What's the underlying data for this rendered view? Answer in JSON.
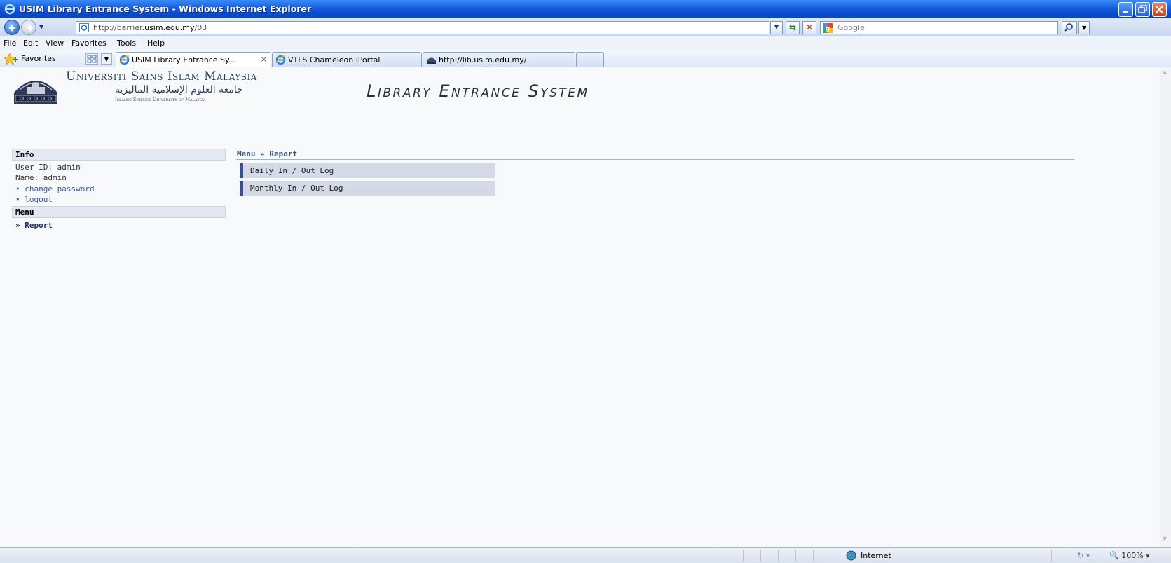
{
  "window": {
    "title": "USIM Library Entrance System - Windows Internet Explorer"
  },
  "address": {
    "url_prefix": "http://barrier.",
    "url_domain": "usim.edu.my",
    "url_suffix": "/03",
    "search_placeholder": "Google"
  },
  "menu": {
    "file": "File",
    "edit": "Edit",
    "view": "View",
    "favorites": "Favorites",
    "tools": "Tools",
    "help": "Help"
  },
  "favbar": {
    "favorites_label": "Favorites",
    "tabs": [
      {
        "label": "USIM Library Entrance Sy...",
        "close": "×",
        "icon": "ie-icon"
      },
      {
        "label": "VTLS Chameleon iPortal",
        "icon": "ie-icon"
      },
      {
        "label": "http://lib.usim.edu.my/",
        "icon": "library-icon"
      }
    ]
  },
  "header": {
    "university_name": "Universiti Sains Islam Malaysia",
    "university_arabic": "جامعة العلوم الإسلامية الماليزية",
    "university_sub": "Islamic Science University of Malaysia",
    "system_title": "Library Entrance System"
  },
  "sidebar": {
    "info_heading": "Info",
    "user_id": "User ID: admin",
    "name": "Name: admin",
    "bullet": "•",
    "change_password": "change password",
    "logout": "logout",
    "menu_heading": "Menu",
    "menu_items": [
      {
        "label": "» Report"
      }
    ]
  },
  "main": {
    "breadcrumb": "Menu » Report",
    "report_items": [
      {
        "label": "Daily In / Out Log"
      },
      {
        "label": "Monthly In / Out Log"
      }
    ]
  },
  "statusbar": {
    "zone": "Internet",
    "zoom": "100%",
    "zoom_icon": "🔍",
    "protected_icon": "↻"
  },
  "colors": {
    "titlebar": "#0b4fd1",
    "accent": "#3a4f8f",
    "content_bg": "#f8f9fb"
  }
}
